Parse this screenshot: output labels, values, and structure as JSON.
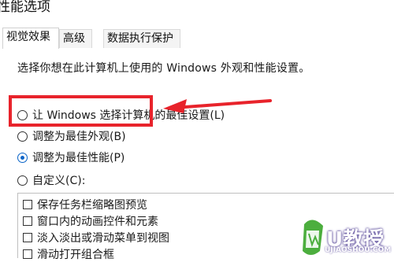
{
  "window": {
    "title": "性能选项"
  },
  "tabs": [
    {
      "label": "视觉效果",
      "active": true
    },
    {
      "label": "高级",
      "active": false
    },
    {
      "label": "数据执行保护",
      "active": false
    }
  ],
  "panel": {
    "description": "选择你想在此计算机上使用的 Windows 外观和性能设置。",
    "options": [
      {
        "label": "让 Windows 选择计算机的最佳设置(L)",
        "checked": false
      },
      {
        "label": "调整为最佳外观(B)",
        "checked": false
      },
      {
        "label": "调整为最佳性能(P)",
        "checked": true
      },
      {
        "label": "自定义(C):",
        "checked": false
      }
    ],
    "effects": [
      {
        "label": "保存任务栏缩略图预览",
        "checked": false
      },
      {
        "label": "窗口内的动画控件和元素",
        "checked": false
      },
      {
        "label": "淡入淡出或滑动菜单到视图",
        "checked": false
      },
      {
        "label": "滑动打开组合框",
        "checked": false
      }
    ]
  },
  "annotation": {
    "highlight_color": "#e8232b"
  },
  "watermark": {
    "brand": "U教授",
    "url": "UJIAOSHOU.COM"
  },
  "colors": {
    "accent": "#0a64c8",
    "watermark_green": "#4cae3e"
  }
}
